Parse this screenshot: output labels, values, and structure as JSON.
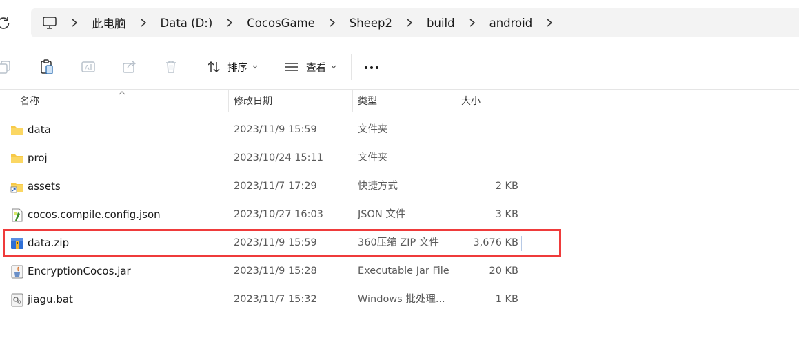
{
  "address": {
    "crumbs": [
      "此电脑",
      "Data (D:)",
      "CocosGame",
      "Sheep2",
      "build",
      "android"
    ]
  },
  "toolbar": {
    "sort_label": "排序",
    "view_label": "查看"
  },
  "columns": {
    "name": "名称",
    "modified": "修改日期",
    "type": "类型",
    "size": "大小"
  },
  "files": [
    {
      "icon": "folder-icon",
      "name": "data",
      "modified": "2023/11/9 15:59",
      "type": "文件夹",
      "size": ""
    },
    {
      "icon": "folder-icon",
      "name": "proj",
      "modified": "2023/10/24 15:11",
      "type": "文件夹",
      "size": ""
    },
    {
      "icon": "shortcut-folder-icon",
      "name": "assets",
      "modified": "2023/11/7 17:29",
      "type": "快捷方式",
      "size": "2 KB"
    },
    {
      "icon": "json-file-icon",
      "name": "cocos.compile.config.json",
      "modified": "2023/10/27 16:03",
      "type": "JSON 文件",
      "size": "3 KB"
    },
    {
      "icon": "zip-archive-icon",
      "name": "data.zip",
      "modified": "2023/11/9 15:59",
      "type": "360压缩 ZIP 文件",
      "size": "3,676 KB"
    },
    {
      "icon": "jar-file-icon",
      "name": "EncryptionCocos.jar",
      "modified": "2023/11/9 15:28",
      "type": "Executable Jar File",
      "size": "20 KB"
    },
    {
      "icon": "bat-file-icon",
      "name": "jiagu.bat",
      "modified": "2023/11/7 15:32",
      "type": "Windows 批处理...",
      "size": "1 KB"
    }
  ],
  "colors": {
    "highlight": "#ef3b3b",
    "folder": "#f7c948"
  }
}
